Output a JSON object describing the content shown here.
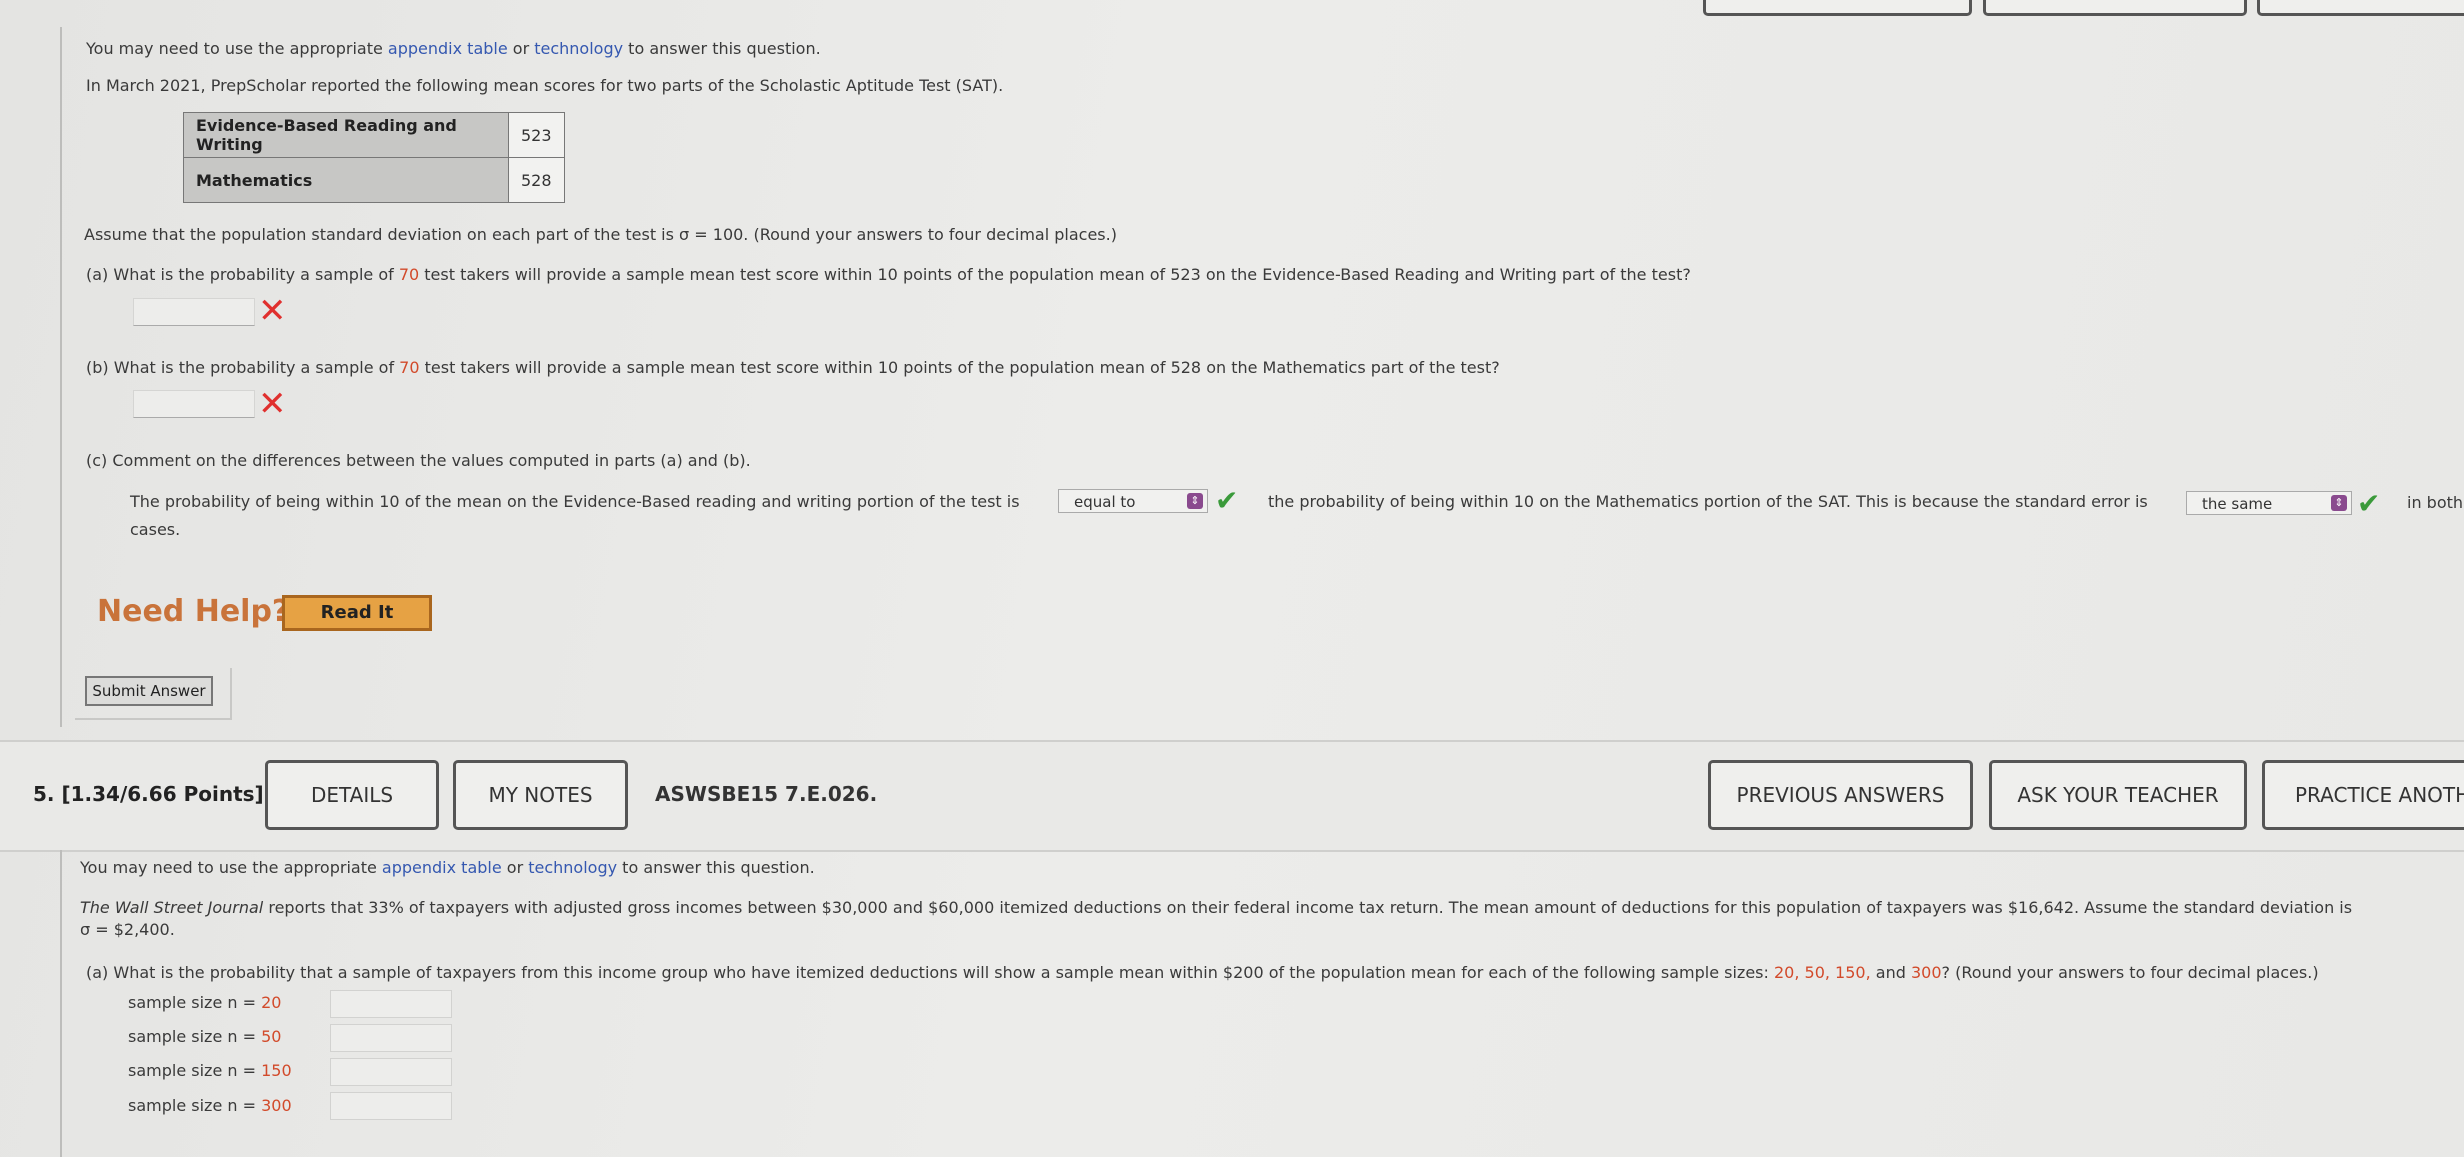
{
  "q4": {
    "intro_pre": "You may need to use the appropriate ",
    "intro_link1": "appendix table",
    "intro_mid": " or ",
    "intro_link2": "technology",
    "intro_post": " to answer this question.",
    "context": "In March 2021, PrepScholar reported the following mean scores for two parts of the Scholastic Aptitude Test (SAT).",
    "table": [
      {
        "label": "Evidence-Based Reading and Writing",
        "value": "523"
      },
      {
        "label": "Mathematics",
        "value": "528"
      }
    ],
    "assume": "Assume that the population standard deviation on each part of the test is σ = 100. (Round your answers to four decimal places.)",
    "part_a_pre": "(a)   What is the probability a sample of ",
    "part_a_num": "70",
    "part_a_post": " test takers will provide a sample mean test score within 10 points of the population mean of 523 on the Evidence-Based Reading and Writing part of the test?",
    "part_b_pre": "(b)   What is the probability a sample of ",
    "part_b_num": "70",
    "part_b_post": " test takers will provide a sample mean test score within 10 points of the population mean of 528 on the Mathematics part of the test?",
    "part_c": "(c)   Comment on the differences between the values computed in parts (a) and (b).",
    "c_sentence1": "The probability of being within 10 of the mean on the Evidence-Based reading and writing portion of the test is",
    "c_select1": "equal to",
    "c_sentence2": "the probability of being within 10 on the Mathematics portion of the SAT. This is because the standard error is",
    "c_select2": "the same",
    "c_sentence3": "in both",
    "c_sentence4": "cases.",
    "need_help": "Need Help?",
    "read_it": "Read It",
    "submit": "Submit Answer"
  },
  "q5": {
    "number": "5.  [1.34/6.66 Points]",
    "details": "DETAILS",
    "my_notes": "MY NOTES",
    "code": "ASWSBE15 7.E.026.",
    "prev_answers": "PREVIOUS ANSWERS",
    "ask_teacher": "ASK YOUR TEACHER",
    "practice": "PRACTICE ANOTH",
    "intro_pre": "You may need to use the appropriate ",
    "intro_link1": "appendix table",
    "intro_mid": " or ",
    "intro_link2": "technology",
    "intro_post": " to answer this question.",
    "context_italic": "The Wall Street Journal",
    "context_rest": " reports that 33% of taxpayers with adjusted gross incomes between $30,000 and $60,000 itemized deductions on their federal income tax return. The mean amount of deductions for this population of taxpayers was $16,642. Assume the standard deviation is",
    "context_line2": "σ = $2,400.",
    "part_a_pre": "(a)   What is the probability that a sample of taxpayers from this income group who have itemized deductions will show a sample mean within $200 of the population mean for each of the following sample sizes: ",
    "part_a_nums": "20, 50, 150,",
    "part_a_and": " and ",
    "part_a_num4": "300",
    "part_a_post": "? (Round your answers to four decimal places.)",
    "samples": [
      {
        "label": "sample size n = ",
        "n": "20"
      },
      {
        "label": "sample size n = ",
        "n": "50"
      },
      {
        "label": "sample size n = ",
        "n": "150"
      },
      {
        "label": "sample size n = ",
        "n": "300"
      }
    ]
  },
  "colors": {
    "accent_link": "#3558b0",
    "number_red": "#d24a2a",
    "wrong": "#e0302e",
    "correct": "#3a9a3a",
    "help": "#c9733a"
  },
  "icons": [
    "x-mark-icon",
    "check-icon",
    "dropdown-arrow-icon"
  ]
}
